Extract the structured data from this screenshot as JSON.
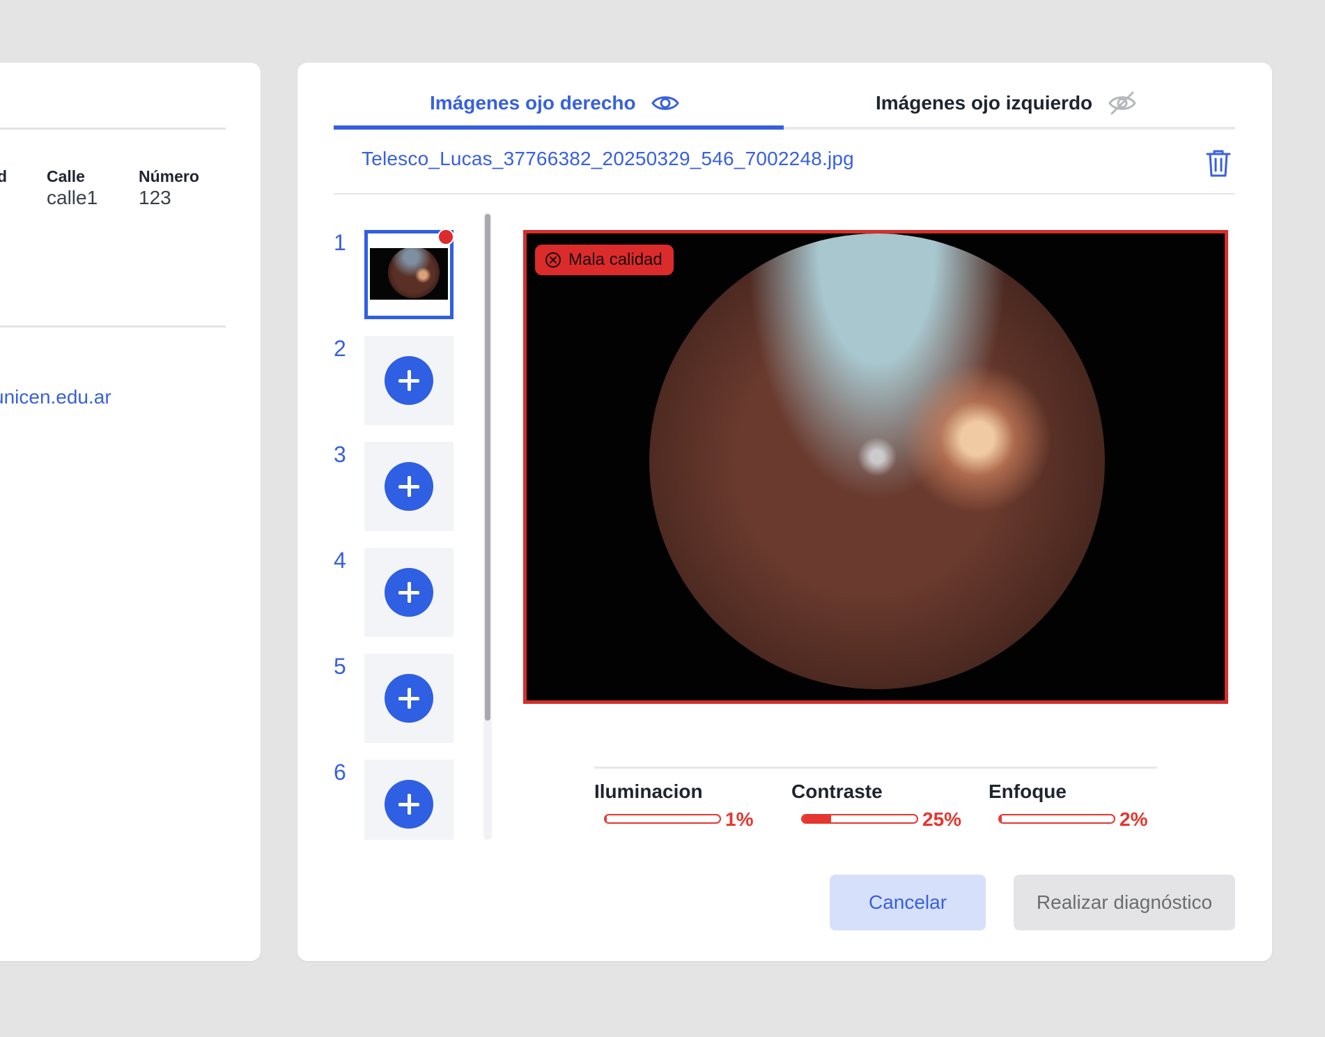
{
  "left_card": {
    "col_fragment": "d",
    "street_label": "Calle",
    "street_value": "calle1",
    "number_label": "Número",
    "number_value": "123",
    "email_fragment": "unicen.edu.ar"
  },
  "tabs": [
    {
      "label": "Imágenes ojo derecho",
      "icon": "eye-icon",
      "active": true
    },
    {
      "label": "Imágenes ojo izquierdo",
      "icon": "eye-off-icon",
      "active": false
    }
  ],
  "file": {
    "name": "Telesco_Lucas_37766382_20250329_546_7002248.jpg",
    "delete_icon": "trash-icon"
  },
  "thumbnails": {
    "numbers": [
      "1",
      "2",
      "3",
      "4",
      "5",
      "6"
    ],
    "add_icon": "plus-icon"
  },
  "image": {
    "quality_label": "Mala calidad",
    "quality_icon": "x-circle-icon"
  },
  "metrics": [
    {
      "label": "Iluminacion",
      "value": 1,
      "display": "1%"
    },
    {
      "label": "Contraste",
      "value": 25,
      "display": "25%"
    },
    {
      "label": "Enfoque",
      "value": 2,
      "display": "2%"
    }
  ],
  "buttons": {
    "cancel": "Cancelar",
    "diagnose": "Realizar diagnóstico"
  },
  "colors": {
    "accent": "#3760e0",
    "error": "#dc2b2b",
    "background": "#e4e4e4"
  }
}
